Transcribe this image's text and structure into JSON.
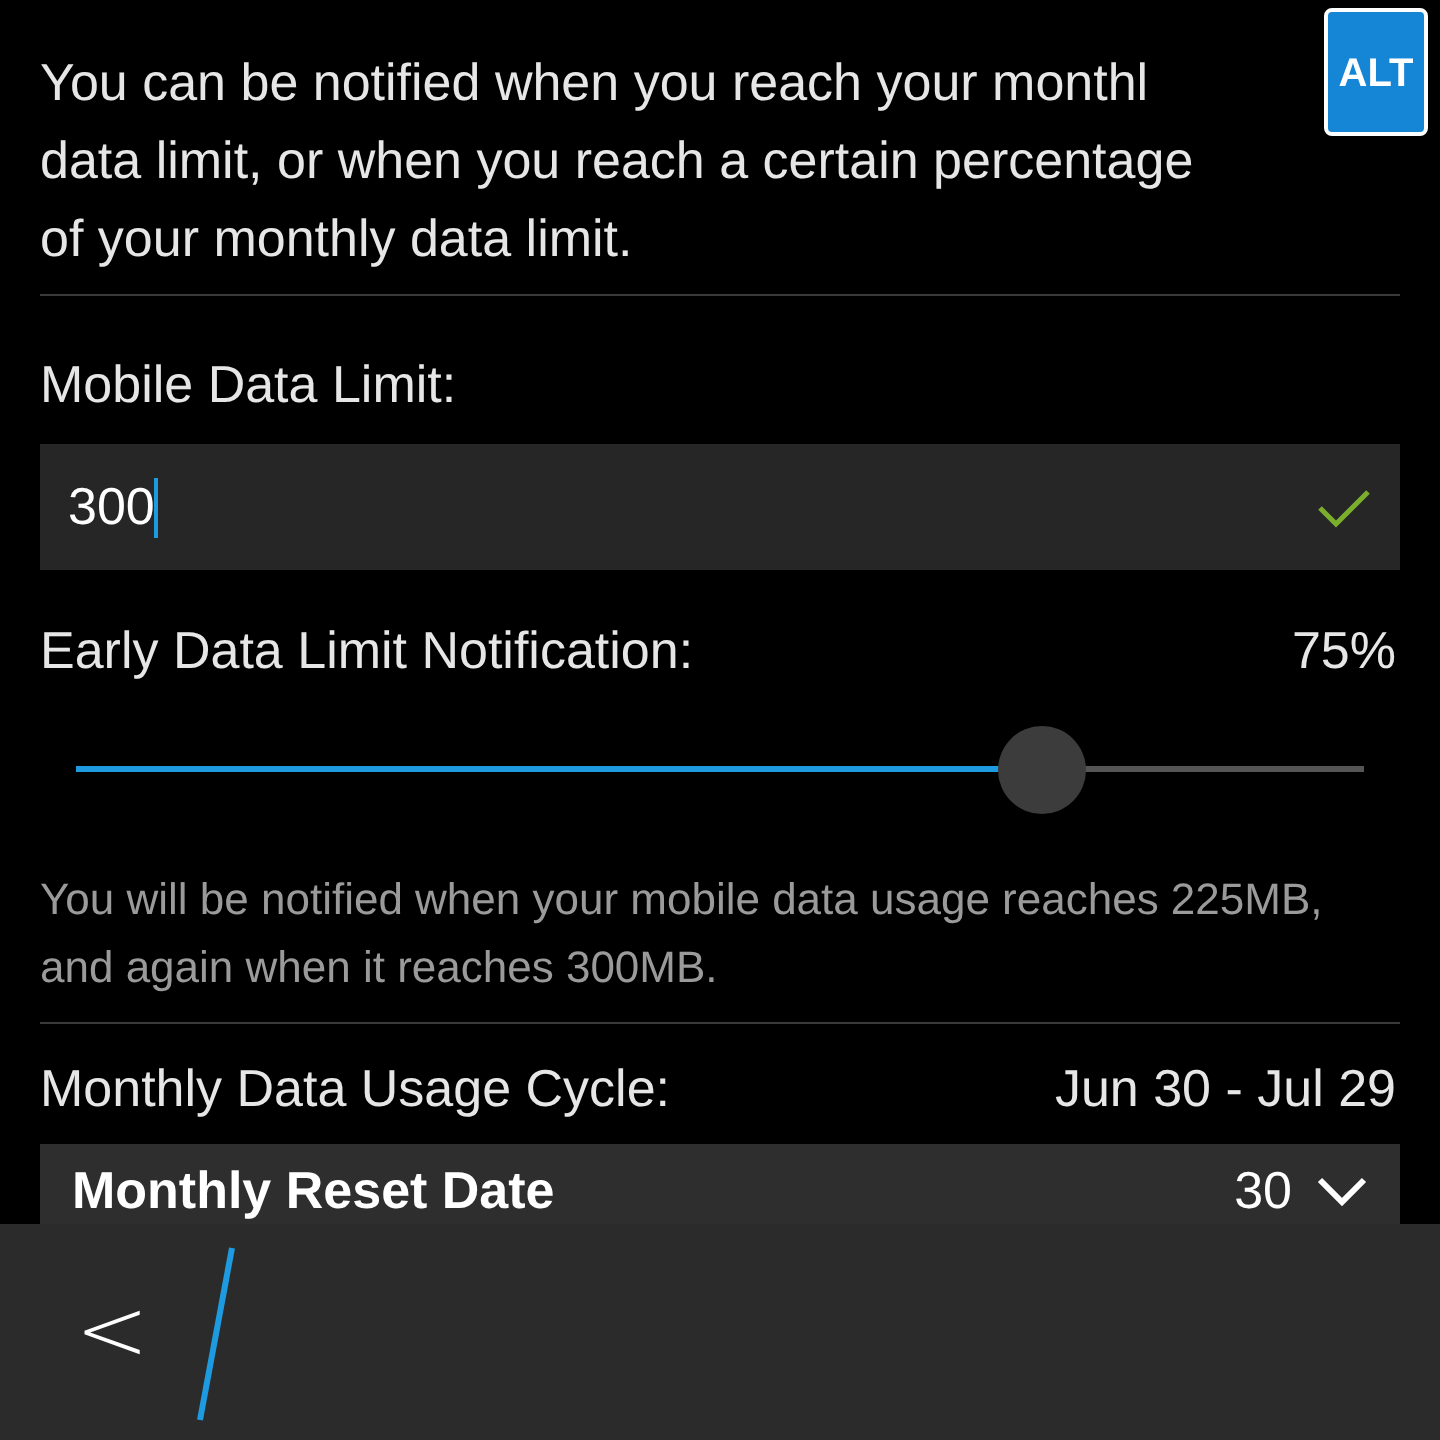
{
  "intro_lines": [
    "You can be notified when you reach your monthl",
    "data limit, or when you reach a certain percentage",
    "of your monthly data limit."
  ],
  "alt_badge": "ALT",
  "data_limit": {
    "label": "Mobile Data Limit:",
    "value": "300",
    "valid": true
  },
  "notification": {
    "label": "Early Data Limit Notification:",
    "reading": "75%",
    "level": 0.75
  },
  "note": "You will be notified when your mobile data usage reaches 225MB, and again when it reaches 300MB.",
  "cycle": {
    "label": "Monthly Data Usage Cycle:",
    "value": "Jun 30 - Jul 29"
  },
  "reset_date": {
    "label": "Monthly Reset Date",
    "value": "30",
    "expanded": false
  },
  "back_button": "<"
}
